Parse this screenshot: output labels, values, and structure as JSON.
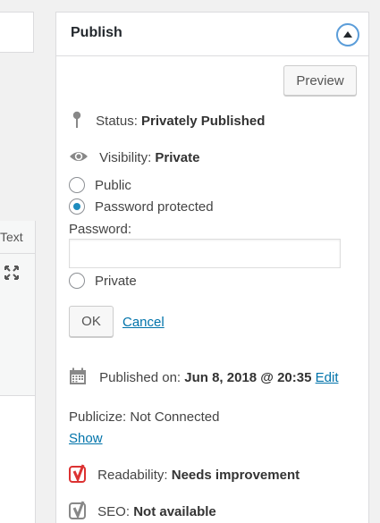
{
  "editor": {
    "text_tab_label": "Text"
  },
  "publish": {
    "title": "Publish",
    "preview_label": "Preview",
    "status_label": "Status:",
    "status_value": "Privately Published",
    "visibility_label": "Visibility:",
    "visibility_value": "Private",
    "visibility_options": [
      {
        "label": "Public",
        "checked": false
      },
      {
        "label": "Password protected",
        "checked": true
      },
      {
        "label": "Private",
        "checked": false
      }
    ],
    "password_label": "Password:",
    "password_value": "",
    "ok_label": "OK",
    "cancel_label": "Cancel",
    "published_on_label": "Published on:",
    "published_on_value": "Jun 8, 2018 @ 20:35",
    "edit_label": "Edit",
    "publicize_label": "Publicize: Not Connected",
    "show_label": "Show",
    "readability_label": "Readability:",
    "readability_value": "Needs improvement",
    "seo_label": "SEO:",
    "seo_value": "Not available"
  },
  "colors": {
    "link": "#0073aa",
    "radio_checked": "#1e8cbe",
    "yoast_red": "#dc3232",
    "yoast_gray": "#888888"
  },
  "icons": [
    "pin-icon",
    "eye-icon",
    "calendar-icon",
    "yoast-red-icon",
    "yoast-gray-icon",
    "expand-icon",
    "collapse-arrow-icon"
  ]
}
